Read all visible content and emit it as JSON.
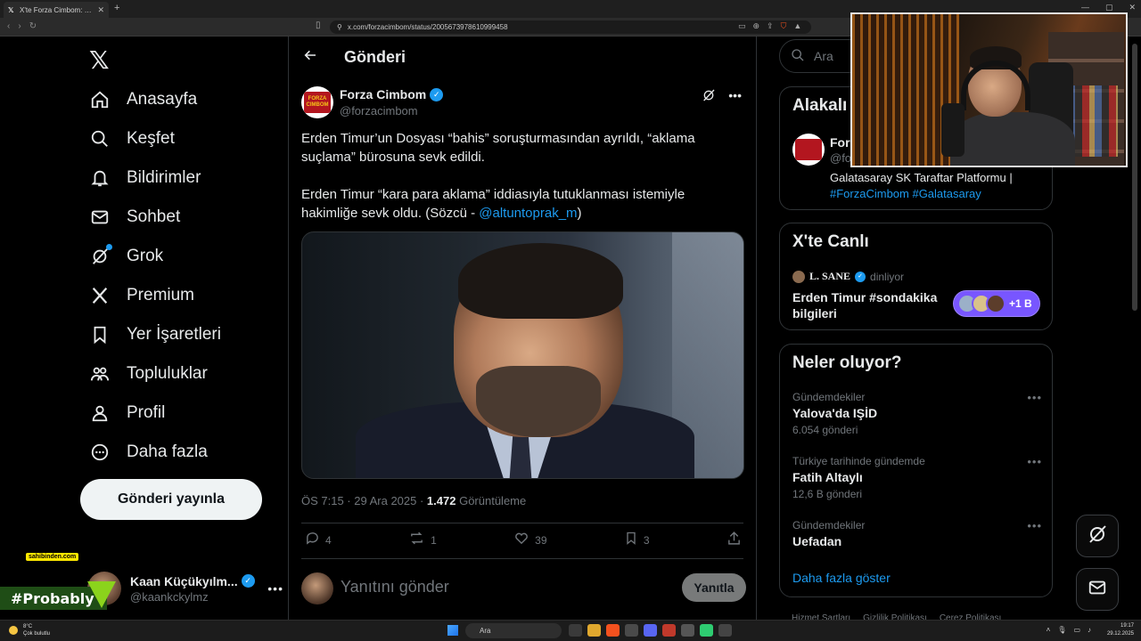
{
  "browser": {
    "tab_title": "X'te Forza Cimbom: \"Erden Timur...",
    "url": "x.com/forzacimbom/status/2005673978610999458"
  },
  "sidebar": {
    "items": [
      {
        "label": "Anasayfa",
        "icon": "home-icon"
      },
      {
        "label": "Keşfet",
        "icon": "search-icon"
      },
      {
        "label": "Bildirimler",
        "icon": "bell-icon"
      },
      {
        "label": "Sohbet",
        "icon": "mail-icon"
      },
      {
        "label": "Grok",
        "icon": "grok-icon"
      },
      {
        "label": "Premium",
        "icon": "x-icon"
      },
      {
        "label": "Yer İşaretleri",
        "icon": "bookmark-icon"
      },
      {
        "label": "Topluluklar",
        "icon": "communities-icon"
      },
      {
        "label": "Profil",
        "icon": "person-icon"
      },
      {
        "label": "Daha fazla",
        "icon": "more-circle-icon"
      }
    ],
    "post_button": "Gönderi yayınla",
    "account": {
      "name": "Kaan Küçükyılm...",
      "handle": "@kaankckylmz"
    }
  },
  "overlays": {
    "sahibinden": "sahibinden.com",
    "probably": "#Probably"
  },
  "main": {
    "title": "Gönderi",
    "post": {
      "author_name": "Forza Cimbom",
      "author_handle": "@forzacimbom",
      "avatar_text": "FORZA CIMBOM",
      "paragraph_1": "Erden Timur’un Dosyası “bahis” soruşturmasından ayrıldı, “aklama suçlama” bürosuna sevk edildi.",
      "paragraph_2_text": "Erden Timur “kara para aklama” iddiasıyla tutuklanması istemiyle hakimliğe sevk oldu. (Sözcü - ",
      "paragraph_2_mention": "@altuntoprak_m",
      "paragraph_2_end": ")",
      "time": "ÖS 7:15 · 29 Ara 2025 · ",
      "views": "1.472",
      "views_label": " Görüntüleme",
      "replies": "4",
      "reposts": "1",
      "likes": "39",
      "bookmarks": "3"
    },
    "reply_placeholder": "Yanıtını gönder",
    "reply_button": "Yanıtla"
  },
  "right": {
    "search_placeholder": "Ara",
    "related": {
      "title": "Alakalı",
      "name": "Forza Cimbom",
      "handle": "@forzacimbom",
      "bio_text": "Galatasaray SK Taraftar Platformu | ",
      "bio_tags": "#ForzaCimbom #Galatasaray"
    },
    "live": {
      "title": "X'te Canlı",
      "host": "L. SANE",
      "host_status": "dinliyor",
      "space_title": "Erden Timur #sondakika bilgileri",
      "listeners": "+1 B"
    },
    "trends_title": "Neler oluyor?",
    "trends": [
      {
        "context": "Gündemdekiler",
        "title": "Yalova'da IŞİD",
        "count": "6.054 gönderi"
      },
      {
        "context": "Türkiye tarihinde gündemde",
        "title": "Fatih Altaylı",
        "count": "12,6 B gönderi"
      },
      {
        "context": "Gündemdekiler",
        "title": "Uefadan",
        "count": ""
      }
    ],
    "show_more": "Daha fazla göster",
    "footer": [
      "Hizmet Şartları",
      "Gizlilik Politikası",
      "Çerez Politikası"
    ]
  },
  "taskbar": {
    "temp": "8°C",
    "weather": "Çok bulutlu",
    "search": "Ara",
    "time": "19:17",
    "date": "29.12.2025"
  },
  "colors": {
    "accent": "#1d9bf0",
    "background": "#000000",
    "border": "#2f3336",
    "muted": "#71767b"
  }
}
